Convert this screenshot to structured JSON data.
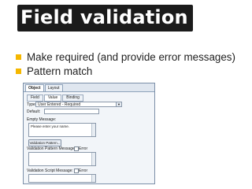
{
  "slide": {
    "title": "Field validation",
    "bullets": [
      "Make required (and provide error messages)",
      "Pattern match"
    ]
  },
  "screenshot": {
    "tabs": [
      "Object",
      "Layout"
    ],
    "subtabs": [
      "Field",
      "Value",
      "Binding"
    ],
    "type_label": "Type:",
    "type_value": "User Entered - Required",
    "default_label": "Default:",
    "empty_message_label": "Empty Message:",
    "empty_message_value": "Please enter your name.",
    "validation_pattern_button": "Validation Pattern...",
    "validation_pattern_message_label": "Validation Pattern Message:",
    "validation_script_message_label": "Validation Script Message:",
    "error_label": "Error"
  },
  "colors": {
    "title_bg": "#1b1b1b",
    "bullet": "#f5b700"
  }
}
